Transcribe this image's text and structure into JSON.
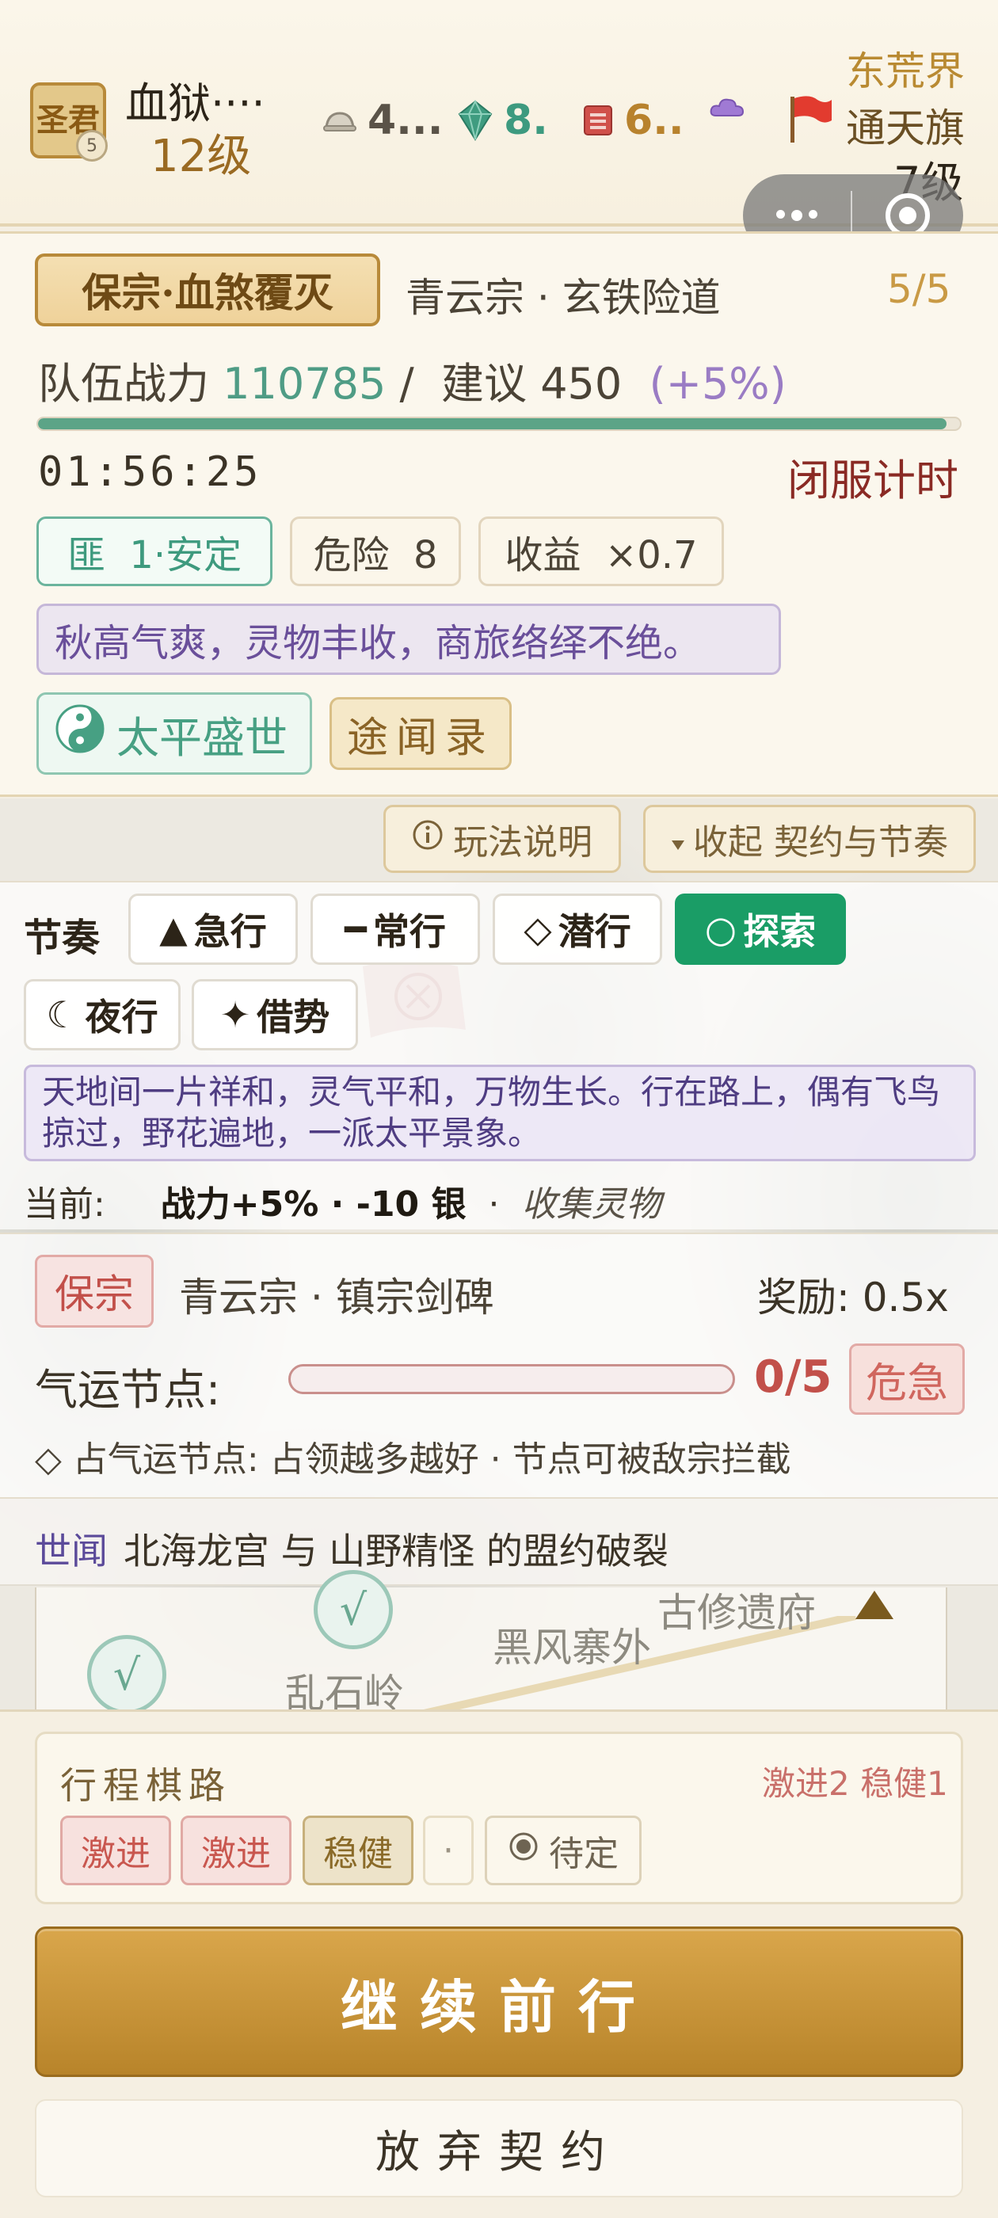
{
  "header": {
    "avatar_text": "圣君",
    "avatar_badge": "5",
    "player_name": "血狱····",
    "player_level": "12级",
    "resources": [
      {
        "icon": "hat-icon",
        "value": "4..."
      },
      {
        "icon": "gem-icon",
        "value": "8."
      },
      {
        "icon": "book-icon",
        "value": "6.."
      },
      {
        "icon": "cloud-icon",
        "value": ""
      }
    ],
    "realm_name": "东荒界",
    "realm_flag": "通天旗",
    "realm_level": "7级"
  },
  "mission": {
    "tag": "保宗·血煞覆灭",
    "place": "青云宗 · 玄铁险道",
    "count": "5/5",
    "power_label": "队伍战力",
    "power_value": "110785",
    "power_sep": "/",
    "suggest_label": "建议",
    "suggest_value": "450",
    "bonus": "(+5%)",
    "progress": 0.985,
    "timer": "01:56:25",
    "closing_label": "闭服计时",
    "chips": {
      "region": "匪  1·安定",
      "danger": "危险  8",
      "yield": "收益  ×0.7"
    },
    "season_text": "秋高气爽，灵物丰收，商旅络绎不绝。",
    "era": "太平盛世",
    "rumor_button": "途闻录"
  },
  "controls": {
    "help": "玩法说明",
    "collapse": "收起 契约与节奏"
  },
  "pace": {
    "label": "节奏",
    "options": [
      {
        "glyph": "▲",
        "label": "急行"
      },
      {
        "glyph": "━",
        "label": "常行"
      },
      {
        "glyph": "◇",
        "label": "潜行"
      },
      {
        "glyph": "○",
        "label": "探索"
      },
      {
        "glyph": "☾",
        "label": "夜行"
      },
      {
        "glyph": "✦",
        "label": "借势"
      }
    ],
    "active_index": 3,
    "description": "天地间一片祥和，灵气平和，万物生长。行在路上，偶有飞鸟掠过，野花遍地，一派太平景象。",
    "current_label": "当前:",
    "current_effect": "战力+5% · -10 银",
    "current_dot": "·",
    "current_task": "收集灵物"
  },
  "sect": {
    "tag": "保宗",
    "name": "青云宗 · 镇宗剑碑",
    "reward": "奖励: 0.5x",
    "node_label": "气运节点:",
    "node_progress": 0,
    "node_count": "0/5",
    "urgent": "危急",
    "hint": "◇ 占气运节点: 占领越多越好 · 节点可被敌宗拦截"
  },
  "news": {
    "label": "世闻",
    "text": "北海龙宫 与 山野精怪 的盟约破裂"
  },
  "map": {
    "labels": [
      "乱石岭",
      "黑风寨外",
      "古修遗府"
    ]
  },
  "route": {
    "title": "行程棋路",
    "stat": "激进2 稳健1",
    "steps": [
      {
        "type": "aggr",
        "label": "激进"
      },
      {
        "type": "aggr",
        "label": "激进"
      },
      {
        "type": "safe",
        "label": "稳健"
      },
      {
        "type": "dot",
        "label": "·"
      },
      {
        "type": "pend",
        "label": "待定"
      }
    ]
  },
  "actions": {
    "continue": "继续前行",
    "abandon": "放弃契约"
  },
  "colors": {
    "accent_gold": "#c8963a",
    "accent_green": "#1a9d66",
    "danger_red": "#c2504a",
    "purple": "#6a4f9a"
  }
}
